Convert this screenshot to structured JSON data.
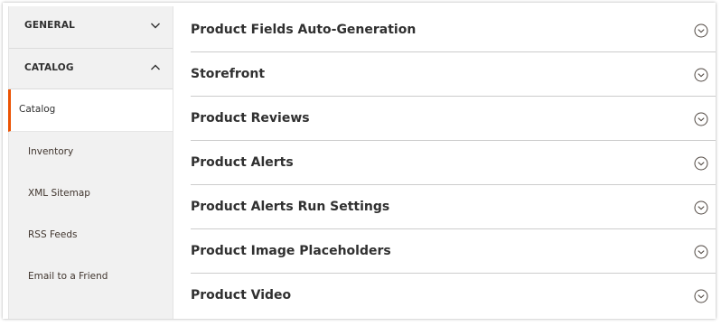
{
  "sidebar": {
    "sections": [
      {
        "label": "GENERAL",
        "state": "collapsed"
      },
      {
        "label": "CATALOG",
        "state": "expanded"
      }
    ],
    "items": [
      {
        "label": "Catalog",
        "active": true
      },
      {
        "label": "Inventory",
        "active": false
      },
      {
        "label": "XML Sitemap",
        "active": false
      },
      {
        "label": "RSS Feeds",
        "active": false
      },
      {
        "label": "Email to a Friend",
        "active": false
      }
    ]
  },
  "main": {
    "groups": [
      {
        "title": "Product Fields Auto-Generation",
        "icon": "expand-circle-icon"
      },
      {
        "title": "Storefront",
        "icon": "expand-circle-icon"
      },
      {
        "title": "Product Reviews",
        "icon": "expand-circle-icon"
      },
      {
        "title": "Product Alerts",
        "icon": "expand-circle-icon"
      },
      {
        "title": "Product Alerts Run Settings",
        "icon": "expand-circle-icon"
      },
      {
        "title": "Product Image Placeholders",
        "icon": "expand-circle-icon"
      },
      {
        "title": "Product Video",
        "icon": "expand-circle-icon"
      }
    ]
  },
  "colors": {
    "accent": "#eb5202",
    "sidebar_bg": "#f1f1f1",
    "text": "#303030"
  }
}
